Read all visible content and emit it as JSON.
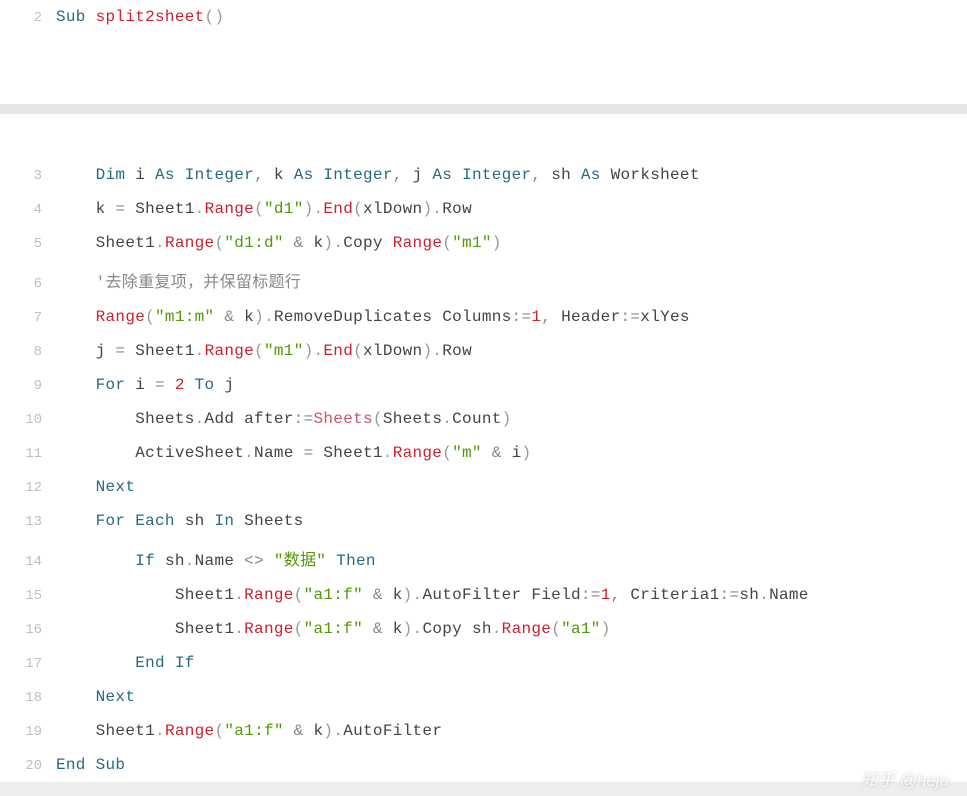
{
  "watermark": "知乎 @heju",
  "lines": [
    {
      "n": 2,
      "indent": 0,
      "tokens": [
        {
          "t": "Sub ",
          "c": "kw"
        },
        {
          "t": "split2sheet",
          "c": "fn"
        },
        {
          "t": "()",
          "c": "par"
        }
      ]
    },
    {
      "n": null,
      "section_break": true
    },
    {
      "n": 3,
      "indent": 1,
      "tokens": [
        {
          "t": "Dim ",
          "c": "kw"
        },
        {
          "t": "i ",
          "c": "id"
        },
        {
          "t": "As ",
          "c": "kw"
        },
        {
          "t": "Integer",
          "c": "kw"
        },
        {
          "t": ", ",
          "c": "op"
        },
        {
          "t": "k ",
          "c": "id"
        },
        {
          "t": "As ",
          "c": "kw"
        },
        {
          "t": "Integer",
          "c": "kw"
        },
        {
          "t": ", ",
          "c": "op"
        },
        {
          "t": "j ",
          "c": "id"
        },
        {
          "t": "As ",
          "c": "kw"
        },
        {
          "t": "Integer",
          "c": "kw"
        },
        {
          "t": ", ",
          "c": "op"
        },
        {
          "t": "sh ",
          "c": "id"
        },
        {
          "t": "As ",
          "c": "kw"
        },
        {
          "t": "Worksheet",
          "c": "id"
        }
      ]
    },
    {
      "n": 4,
      "indent": 1,
      "tokens": [
        {
          "t": "k ",
          "c": "id"
        },
        {
          "t": "= ",
          "c": "op"
        },
        {
          "t": "Sheet1",
          "c": "id"
        },
        {
          "t": ".",
          "c": "dot"
        },
        {
          "t": "Range",
          "c": "fn"
        },
        {
          "t": "(",
          "c": "par"
        },
        {
          "t": "\"d1\"",
          "c": "str"
        },
        {
          "t": ")",
          "c": "par"
        },
        {
          "t": ".",
          "c": "dot"
        },
        {
          "t": "End",
          "c": "fn"
        },
        {
          "t": "(",
          "c": "par"
        },
        {
          "t": "xlDown",
          "c": "id"
        },
        {
          "t": ")",
          "c": "par"
        },
        {
          "t": ".",
          "c": "dot"
        },
        {
          "t": "Row",
          "c": "id"
        }
      ]
    },
    {
      "n": 5,
      "indent": 1,
      "tokens": [
        {
          "t": "Sheet1",
          "c": "id"
        },
        {
          "t": ".",
          "c": "dot"
        },
        {
          "t": "Range",
          "c": "fn"
        },
        {
          "t": "(",
          "c": "par"
        },
        {
          "t": "\"d1:d\"",
          "c": "str"
        },
        {
          "t": " & ",
          "c": "op"
        },
        {
          "t": "k",
          "c": "id"
        },
        {
          "t": ")",
          "c": "par"
        },
        {
          "t": ".",
          "c": "dot"
        },
        {
          "t": "Copy ",
          "c": "id"
        },
        {
          "t": "Range",
          "c": "fn"
        },
        {
          "t": "(",
          "c": "par"
        },
        {
          "t": "\"m1\"",
          "c": "str"
        },
        {
          "t": ")",
          "c": "par"
        }
      ]
    },
    {
      "n": 6,
      "indent": 1,
      "tokens": [
        {
          "t": "'去除重复项，并保留标题行",
          "c": "cmt"
        }
      ]
    },
    {
      "n": 7,
      "indent": 1,
      "tokens": [
        {
          "t": "Range",
          "c": "fn"
        },
        {
          "t": "(",
          "c": "par"
        },
        {
          "t": "\"m1:m\"",
          "c": "str"
        },
        {
          "t": " & ",
          "c": "op"
        },
        {
          "t": "k",
          "c": "id"
        },
        {
          "t": ")",
          "c": "par"
        },
        {
          "t": ".",
          "c": "dot"
        },
        {
          "t": "RemoveDuplicates ",
          "c": "id"
        },
        {
          "t": "Columns",
          "c": "id"
        },
        {
          "t": ":",
          "c": "op"
        },
        {
          "t": "=",
          "c": "op"
        },
        {
          "t": "1",
          "c": "num"
        },
        {
          "t": ", ",
          "c": "op"
        },
        {
          "t": "Header",
          "c": "id"
        },
        {
          "t": ":",
          "c": "op"
        },
        {
          "t": "=",
          "c": "op"
        },
        {
          "t": "xlYes",
          "c": "id"
        }
      ]
    },
    {
      "n": 8,
      "indent": 1,
      "tokens": [
        {
          "t": "j ",
          "c": "id"
        },
        {
          "t": "= ",
          "c": "op"
        },
        {
          "t": "Sheet1",
          "c": "id"
        },
        {
          "t": ".",
          "c": "dot"
        },
        {
          "t": "Range",
          "c": "fn"
        },
        {
          "t": "(",
          "c": "par"
        },
        {
          "t": "\"m1\"",
          "c": "str"
        },
        {
          "t": ")",
          "c": "par"
        },
        {
          "t": ".",
          "c": "dot"
        },
        {
          "t": "End",
          "c": "fn"
        },
        {
          "t": "(",
          "c": "par"
        },
        {
          "t": "xlDown",
          "c": "id"
        },
        {
          "t": ")",
          "c": "par"
        },
        {
          "t": ".",
          "c": "dot"
        },
        {
          "t": "Row",
          "c": "id"
        }
      ]
    },
    {
      "n": 9,
      "indent": 1,
      "tokens": [
        {
          "t": "For ",
          "c": "kw"
        },
        {
          "t": "i ",
          "c": "id"
        },
        {
          "t": "= ",
          "c": "op"
        },
        {
          "t": "2",
          "c": "num"
        },
        {
          "t": " ",
          "c": "id"
        },
        {
          "t": "To ",
          "c": "kw"
        },
        {
          "t": "j",
          "c": "id"
        }
      ]
    },
    {
      "n": 10,
      "indent": 2,
      "tokens": [
        {
          "t": "Sheets",
          "c": "id"
        },
        {
          "t": ".",
          "c": "dot"
        },
        {
          "t": "Add ",
          "c": "id"
        },
        {
          "t": "after",
          "c": "id"
        },
        {
          "t": ":",
          "c": "op"
        },
        {
          "t": "=",
          "c": "op"
        },
        {
          "t": "Sheets",
          "c": "pink"
        },
        {
          "t": "(",
          "c": "par"
        },
        {
          "t": "Sheets",
          "c": "id"
        },
        {
          "t": ".",
          "c": "dot"
        },
        {
          "t": "Count",
          "c": "id"
        },
        {
          "t": ")",
          "c": "par"
        }
      ]
    },
    {
      "n": 11,
      "indent": 2,
      "tokens": [
        {
          "t": "ActiveSheet",
          "c": "id"
        },
        {
          "t": ".",
          "c": "dot"
        },
        {
          "t": "Name ",
          "c": "id"
        },
        {
          "t": "= ",
          "c": "op"
        },
        {
          "t": "Sheet1",
          "c": "id"
        },
        {
          "t": ".",
          "c": "dot"
        },
        {
          "t": "Range",
          "c": "fn"
        },
        {
          "t": "(",
          "c": "par"
        },
        {
          "t": "\"m\"",
          "c": "str"
        },
        {
          "t": " & ",
          "c": "op"
        },
        {
          "t": "i",
          "c": "id"
        },
        {
          "t": ")",
          "c": "par"
        }
      ]
    },
    {
      "n": 12,
      "indent": 1,
      "tokens": [
        {
          "t": "Next",
          "c": "kw"
        }
      ]
    },
    {
      "n": 13,
      "indent": 1,
      "tokens": [
        {
          "t": "For ",
          "c": "kw"
        },
        {
          "t": "Each ",
          "c": "kw"
        },
        {
          "t": "sh ",
          "c": "id"
        },
        {
          "t": "In ",
          "c": "kw"
        },
        {
          "t": "Sheets",
          "c": "id"
        }
      ]
    },
    {
      "n": 14,
      "indent": 2,
      "tokens": [
        {
          "t": "If ",
          "c": "kw"
        },
        {
          "t": "sh",
          "c": "id"
        },
        {
          "t": ".",
          "c": "dot"
        },
        {
          "t": "Name ",
          "c": "id"
        },
        {
          "t": "<> ",
          "c": "op"
        },
        {
          "t": "\"数据\"",
          "c": "str"
        },
        {
          "t": " ",
          "c": "id"
        },
        {
          "t": "Then",
          "c": "kw"
        }
      ]
    },
    {
      "n": 15,
      "indent": 3,
      "tokens": [
        {
          "t": "Sheet1",
          "c": "id"
        },
        {
          "t": ".",
          "c": "dot"
        },
        {
          "t": "Range",
          "c": "fn"
        },
        {
          "t": "(",
          "c": "par"
        },
        {
          "t": "\"a1:f\"",
          "c": "str"
        },
        {
          "t": " & ",
          "c": "op"
        },
        {
          "t": "k",
          "c": "id"
        },
        {
          "t": ")",
          "c": "par"
        },
        {
          "t": ".",
          "c": "dot"
        },
        {
          "t": "AutoFilter ",
          "c": "id"
        },
        {
          "t": "Field",
          "c": "id"
        },
        {
          "t": ":",
          "c": "op"
        },
        {
          "t": "=",
          "c": "op"
        },
        {
          "t": "1",
          "c": "num"
        },
        {
          "t": ", ",
          "c": "op"
        },
        {
          "t": "Criteria1",
          "c": "id"
        },
        {
          "t": ":",
          "c": "op"
        },
        {
          "t": "=",
          "c": "op"
        },
        {
          "t": "sh",
          "c": "id"
        },
        {
          "t": ".",
          "c": "dot"
        },
        {
          "t": "Name",
          "c": "id"
        }
      ]
    },
    {
      "n": 16,
      "indent": 3,
      "tokens": [
        {
          "t": "Sheet1",
          "c": "id"
        },
        {
          "t": ".",
          "c": "dot"
        },
        {
          "t": "Range",
          "c": "fn"
        },
        {
          "t": "(",
          "c": "par"
        },
        {
          "t": "\"a1:f\"",
          "c": "str"
        },
        {
          "t": " & ",
          "c": "op"
        },
        {
          "t": "k",
          "c": "id"
        },
        {
          "t": ")",
          "c": "par"
        },
        {
          "t": ".",
          "c": "dot"
        },
        {
          "t": "Copy ",
          "c": "id"
        },
        {
          "t": "sh",
          "c": "id"
        },
        {
          "t": ".",
          "c": "dot"
        },
        {
          "t": "Range",
          "c": "fn"
        },
        {
          "t": "(",
          "c": "par"
        },
        {
          "t": "\"a1\"",
          "c": "str"
        },
        {
          "t": ")",
          "c": "par"
        }
      ]
    },
    {
      "n": 17,
      "indent": 2,
      "tokens": [
        {
          "t": "End ",
          "c": "kw"
        },
        {
          "t": "If",
          "c": "kw"
        }
      ]
    },
    {
      "n": 18,
      "indent": 1,
      "tokens": [
        {
          "t": "Next",
          "c": "kw"
        }
      ]
    },
    {
      "n": 19,
      "indent": 1,
      "tokens": [
        {
          "t": "Sheet1",
          "c": "id"
        },
        {
          "t": ".",
          "c": "dot"
        },
        {
          "t": "Range",
          "c": "fn"
        },
        {
          "t": "(",
          "c": "par"
        },
        {
          "t": "\"a1:f\"",
          "c": "str"
        },
        {
          "t": " & ",
          "c": "op"
        },
        {
          "t": "k",
          "c": "id"
        },
        {
          "t": ")",
          "c": "par"
        },
        {
          "t": ".",
          "c": "dot"
        },
        {
          "t": "AutoFilter",
          "c": "id"
        }
      ]
    },
    {
      "n": 20,
      "indent": 0,
      "tokens": [
        {
          "t": "End ",
          "c": "kw"
        },
        {
          "t": "Sub",
          "c": "kw"
        }
      ]
    }
  ]
}
